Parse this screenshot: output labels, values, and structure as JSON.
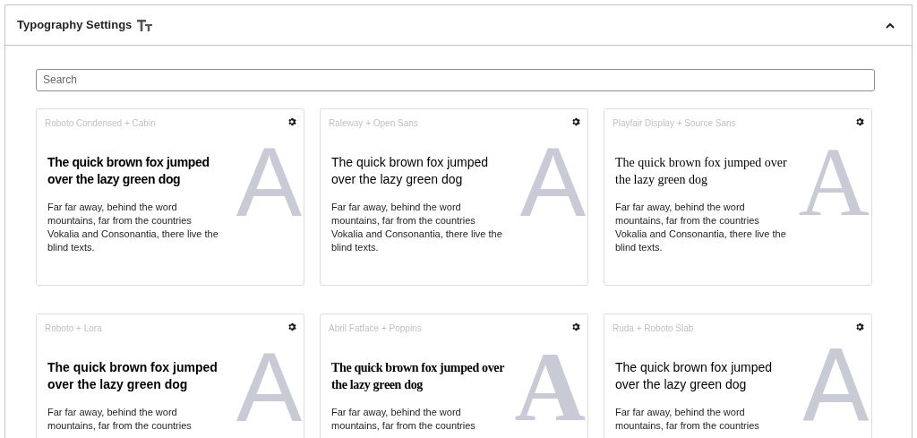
{
  "panel": {
    "title": "Typography Settings",
    "expanded": true
  },
  "search": {
    "placeholder": "Search"
  },
  "cards": [
    {
      "label": "Roboto Condensed + Cabin",
      "heading": "The quick brown fox jumped over the lazy green dog",
      "body": "Far far away, behind the word mountains, far from the countries Vokalia and Consonantia, there live the blind texts.",
      "letter": "A"
    },
    {
      "label": "Raleway + Open Sans",
      "heading": "The quick brown fox jumped over the lazy green dog",
      "body": "Far far away, behind the word mountains, far from the countries Vokalia and Consonantia, there live the blind texts.",
      "letter": "A"
    },
    {
      "label": "Playfair Display + Source Sans",
      "heading": "The quick brown fox jumped over the lazy green dog",
      "body": "Far far away, behind the word mountains, far from the countries Vokalia and Consonantia, there live the blind texts.",
      "letter": "A"
    },
    {
      "label": "Roboto + Lora",
      "heading": "The quick brown fox jumped over the lazy green dog",
      "body": "Far far away, behind the word mountains, far from the countries",
      "letter": "A"
    },
    {
      "label": "Abril Fatface + Poppins",
      "heading": "The quick brown fox jumped over the lazy green dog",
      "body": "Far far away, behind the word mountains, far from the countries",
      "letter": "A"
    },
    {
      "label": "Ruda + Roboto Slab",
      "heading": "The quick brown fox jumped over the lazy green dog",
      "body": "Far far away, behind the word mountains, far from the countries",
      "letter": "A"
    }
  ]
}
